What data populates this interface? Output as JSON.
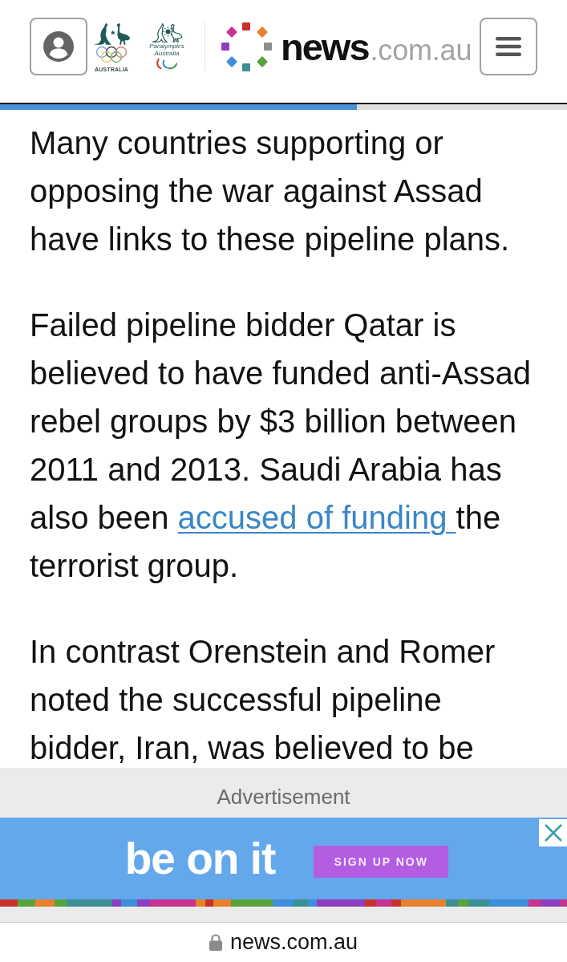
{
  "header": {
    "olympic_logo": {
      "caption": "AUSTRALIA"
    },
    "paralympic_logo": {
      "caption": "Paralympics Australia"
    },
    "site_logo": {
      "name": "news",
      "domain": ".com.au"
    }
  },
  "reading_progress": {
    "level": 0.63
  },
  "article": {
    "paragraphs": [
      {
        "parts": [
          {
            "kind": "text",
            "text": "Many countries supporting or opposing the war against Assad have links to these pipeline plans."
          }
        ]
      },
      {
        "parts": [
          {
            "kind": "text",
            "text": "Failed pipeline bidder Qatar is believed to have funded anti-Assad rebel groups by $3 billion between 2011 and 2013. Saudi Arabia has also been "
          },
          {
            "kind": "link",
            "text": "accused of funding "
          },
          {
            "kind": "text",
            "text": "the terrorist group."
          }
        ]
      },
      {
        "parts": [
          {
            "kind": "text",
            "text": "In contrast Orenstein and Romer noted the successful pipeline bidder, Iran, was believed to be"
          }
        ]
      }
    ]
  },
  "advertisement": {
    "label": "Advertisement",
    "headline": "be on it",
    "button": "SIGN UP NOW"
  },
  "address_bar": {
    "secure": true,
    "url": "news.com.au"
  }
}
